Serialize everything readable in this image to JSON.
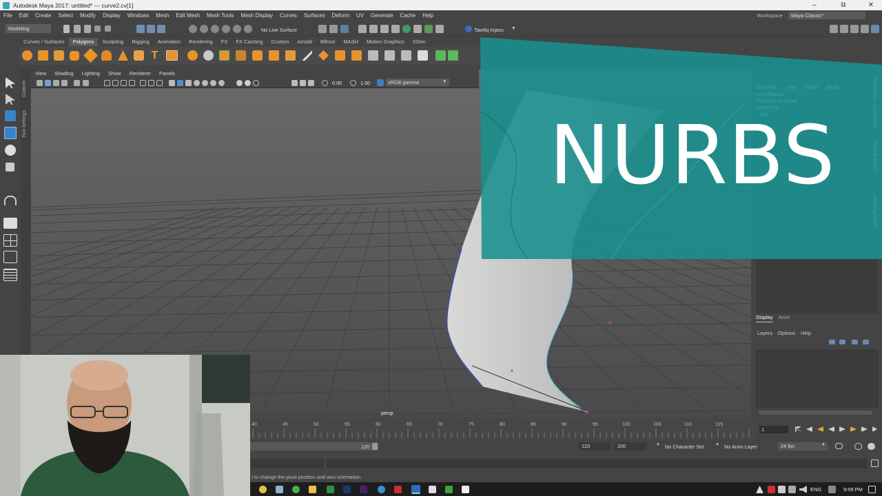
{
  "window": {
    "title": "Autodesk Maya 2017: untitled*   ---   curve2.cv[1]"
  },
  "menubar": [
    "File",
    "Edit",
    "Create",
    "Select",
    "Modify",
    "Display",
    "Windows",
    "Mesh",
    "Edit Mesh",
    "Mesh Tools",
    "Mesh Display",
    "Curves",
    "Surfaces",
    "Deform",
    "UV",
    "Generate",
    "Cache",
    "Help"
  ],
  "workspace": {
    "label": "Workspace :",
    "value": "Maya Classic*"
  },
  "statusline": {
    "mode": "Modeling",
    "live_surface": "No Live Surface",
    "user": "Tawfiq Injass"
  },
  "shelf_tabs": [
    "Curves / Surfaces",
    "Polygons",
    "Sculpting",
    "Rigging",
    "Animation",
    "Rendering",
    "FX",
    "FX Caching",
    "Custom",
    "Arnold",
    "Bifrost",
    "MASH",
    "Motion Graphics",
    "XGen"
  ],
  "shelf_active": "Polygons",
  "side_labels": {
    "outliner": "Outliner",
    "tool_settings": "Tool Settings"
  },
  "viewport": {
    "menu": [
      "View",
      "Shading",
      "Lighting",
      "Show",
      "Renderer",
      "Panels"
    ],
    "camera": "persp",
    "exposure": "0.00",
    "gamma": "1.00",
    "colorspace": "sRGB gamma"
  },
  "channel_box": {
    "menu": [
      "Channels",
      "Edit",
      "Object",
      "Show"
    ],
    "node": "curveShape2",
    "cvs": "CVs (click to show)",
    "outputs": "OUTPUTS",
    "output_node": "loft1"
  },
  "right_tabs": [
    "Channel Box / Layer Editor",
    "Attribute Editor",
    "Modeling Toolkit"
  ],
  "layer_editor": {
    "tabs": [
      "Display",
      "Anim"
    ],
    "menu": [
      "Layers",
      "Options",
      "Help"
    ]
  },
  "timeline": {
    "ticks": [
      "40",
      "45",
      "50",
      "55",
      "60",
      "65",
      "70",
      "75",
      "80",
      "85",
      "90",
      "95",
      "100",
      "105",
      "110",
      "115"
    ],
    "current_frame": "1"
  },
  "range": {
    "end_slider": "120",
    "end": "120",
    "total": "200",
    "character_set": "No Character Set",
    "anim_layer": "No Anim Layer",
    "fps": "24 fps"
  },
  "help_line": "t to change the pivot position and axis orientation.",
  "banner": {
    "text": "NURBS",
    "color": "#1a8f8f"
  },
  "taskbar": {
    "lang": "ENG",
    "time": "9:59 PM"
  }
}
